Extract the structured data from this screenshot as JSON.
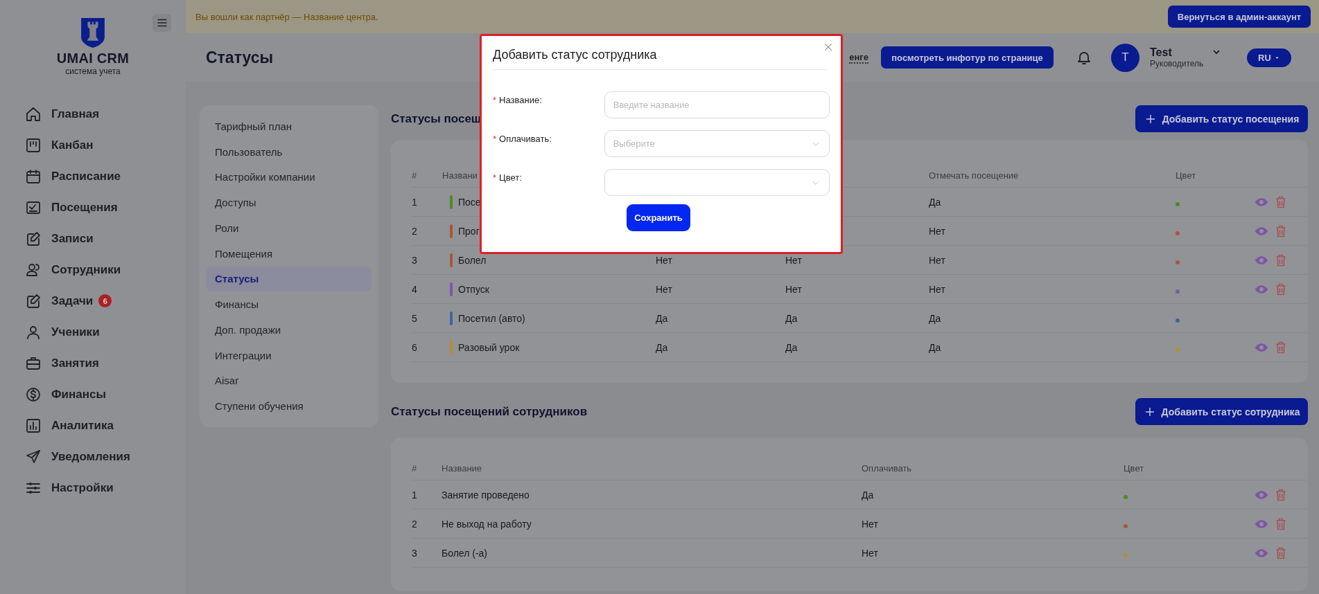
{
  "banner": {
    "text": "Вы вошли как партнёр — Название центра.",
    "button": "Вернуться в админ-аккаунт"
  },
  "sidebar": {
    "logo_title": "UMAI CRM",
    "logo_subtitle": "система учета",
    "items": [
      {
        "label": "Главная"
      },
      {
        "label": "Канбан"
      },
      {
        "label": "Расписание"
      },
      {
        "label": "Посещения"
      },
      {
        "label": "Записи"
      },
      {
        "label": "Сотрудники"
      },
      {
        "label": "Задачи",
        "badge": "6"
      },
      {
        "label": "Ученики"
      },
      {
        "label": "Занятия"
      },
      {
        "label": "Финансы"
      },
      {
        "label": "Аналитика"
      },
      {
        "label": "Уведомления"
      },
      {
        "label": "Настройки"
      }
    ]
  },
  "header": {
    "title": "Статусы",
    "link": "енге",
    "tour_button": "посмотреть инфотур по странице",
    "avatar_letter": "T",
    "user_name": "Test",
    "user_role": "Руководитель",
    "language": "RU"
  },
  "settings_menu": {
    "items": [
      {
        "label": "Тарифный план",
        "selected": false
      },
      {
        "label": "Пользователь",
        "selected": false
      },
      {
        "label": "Настройки компании",
        "selected": false
      },
      {
        "label": "Доступы",
        "selected": false
      },
      {
        "label": "Роли",
        "selected": false
      },
      {
        "label": "Помещения",
        "selected": false
      },
      {
        "label": "Статусы",
        "selected": true
      },
      {
        "label": "Финансы",
        "selected": false
      },
      {
        "label": "Доп. продажи",
        "selected": false
      },
      {
        "label": "Интеграции",
        "selected": false
      },
      {
        "label": "Aisar",
        "selected": false
      },
      {
        "label": "Ступени обучения",
        "selected": false
      }
    ]
  },
  "visit_statuses": {
    "title": "Статусы посещ",
    "add_button": "Добавить статус посещения",
    "columns": {
      "number": "#",
      "name": "Названи",
      "attendance": "Отмечать посещение",
      "color_label": "Цвет"
    },
    "rows": [
      {
        "number": "1",
        "name": "Посе",
        "attendance": "Да",
        "color": "#4f8a22",
        "actions": true
      },
      {
        "number": "2",
        "name": "Прог",
        "attendance": "Нет",
        "color": "#a9553b",
        "actions": true
      },
      {
        "number": "3",
        "name": "Болел",
        "column_3": "Нет",
        "column_4": "Нет",
        "attendance": "Нет",
        "color": "#a9553b",
        "actions": true
      },
      {
        "number": "4",
        "name": "Отпуск",
        "column_3": "Нет",
        "column_4": "Нет",
        "attendance": "Нет",
        "color": "#7b58a8",
        "actions": true
      },
      {
        "number": "5",
        "name": "Посетил (авто)",
        "column_3": "Да",
        "column_4": "Да",
        "attendance": "Да",
        "color": "#3d65a0",
        "actions": false
      },
      {
        "number": "6",
        "name": "Разовый урок",
        "column_3": "Да",
        "column_4": "Да",
        "attendance": "Да",
        "color": "#b08f36",
        "actions": true
      }
    ]
  },
  "employee_statuses": {
    "title": "Статусы посещений сотрудников",
    "add_button": "Добавить статус сотрудника",
    "columns": {
      "number": "#",
      "name": "Название",
      "paid": "Оплачивать",
      "color_label": "Цвет"
    },
    "rows": [
      {
        "number": "1",
        "name": "Занятие проведено",
        "paid": "Да",
        "color": "#4f8a22",
        "actions": true
      },
      {
        "number": "2",
        "name": "Не выход на работу",
        "paid": "Нет",
        "color": "#a9553b",
        "actions": true
      },
      {
        "number": "3",
        "name": "Болел (-а)",
        "paid": "Нет",
        "color": "#b08f36",
        "actions": true
      }
    ]
  },
  "dialog": {
    "title": "Добавить статус сотрудника",
    "fields": [
      {
        "kind": "text",
        "mark": "*",
        "label": "Название:",
        "placeholder": "Введите название"
      },
      {
        "kind": "select",
        "mark": "*",
        "label": "Оплачивать:",
        "placeholder": "Выберите"
      },
      {
        "kind": "select",
        "mark": "*",
        "label": "Цвет:"
      }
    ],
    "save_button": "Сохранить"
  }
}
